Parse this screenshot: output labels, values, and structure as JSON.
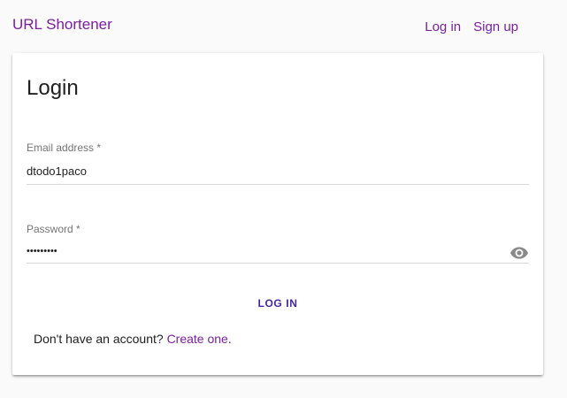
{
  "app": {
    "brand": "URL Shortener"
  },
  "nav": {
    "login_label": "Log in",
    "signup_label": "Sign up"
  },
  "login_card": {
    "title": "Login",
    "email": {
      "label": "Email address *",
      "value": "dtodo1paco"
    },
    "password": {
      "label": "Password *",
      "value": "•••••••••",
      "toggle_icon": "eye-icon"
    },
    "submit_label": "LOG IN",
    "signup_prompt": "Don't have an account?",
    "signup_link": "Create one",
    "signup_suffix": "."
  },
  "colors": {
    "accent": "#7b1fa2",
    "button_text": "#4527a0",
    "background": "#fafafa",
    "card": "#ffffff"
  }
}
